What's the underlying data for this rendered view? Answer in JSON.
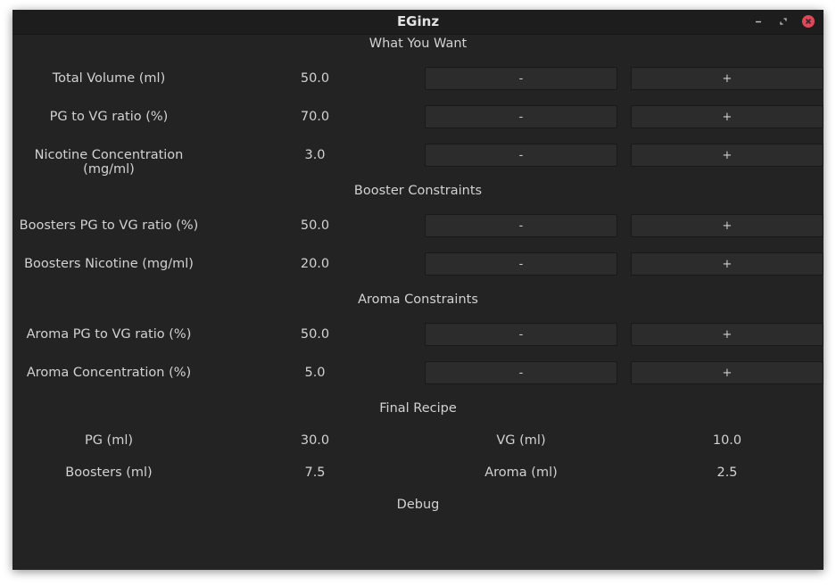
{
  "window": {
    "title": "EGinz"
  },
  "sections": {
    "want": "What You Want",
    "booster": "Booster Constraints",
    "aroma": "Aroma Constraints",
    "final": "Final Recipe",
    "debug": "Debug"
  },
  "buttons": {
    "minus": "-",
    "plus": "+"
  },
  "want": {
    "total_volume": {
      "label": "Total Volume (ml)",
      "value": "50.0"
    },
    "pg_vg": {
      "label": "PG to VG ratio (%)",
      "value": "70.0"
    },
    "nicotine": {
      "label": "Nicotine Concentration (mg/ml)",
      "value": "3.0"
    }
  },
  "booster": {
    "pg_vg": {
      "label": "Boosters PG to VG ratio (%)",
      "value": "50.0"
    },
    "nicotine": {
      "label": "Boosters Nicotine (mg/ml)",
      "value": "20.0"
    }
  },
  "aroma": {
    "pg_vg": {
      "label": "Aroma PG to VG ratio (%)",
      "value": "50.0"
    },
    "concentration": {
      "label": "Aroma Concentration (%)",
      "value": "5.0"
    }
  },
  "final": {
    "pg": {
      "label": "PG (ml)",
      "value": "30.0"
    },
    "vg": {
      "label": "VG (ml)",
      "value": "10.0"
    },
    "boosters": {
      "label": "Boosters (ml)",
      "value": "7.5"
    },
    "aroma": {
      "label": "Aroma (ml)",
      "value": "2.5"
    }
  },
  "icons": {
    "minimize": "minimize-icon",
    "maximize": "maximize-icon",
    "close": "close-icon"
  },
  "colors": {
    "close_button": "#e0485a",
    "background": "#232323"
  }
}
